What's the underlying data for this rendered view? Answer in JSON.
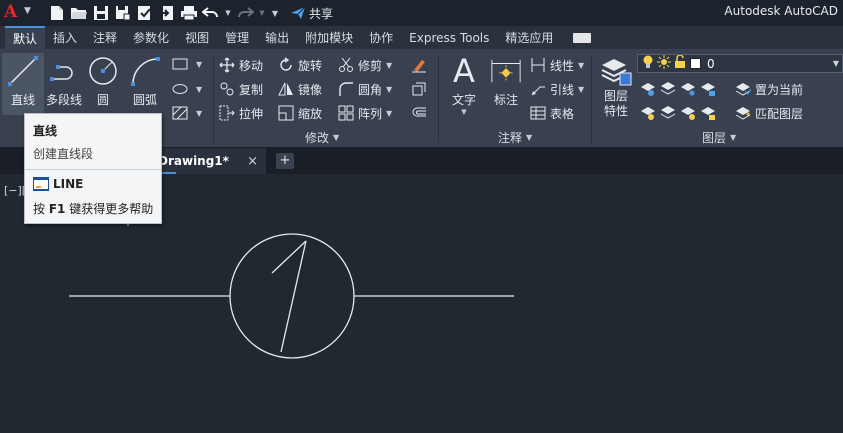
{
  "app": {
    "logo": "A",
    "title": "Autodesk AutoCAD",
    "share_label": "共享"
  },
  "ribbon_tabs": [
    "默认",
    "插入",
    "注释",
    "参数化",
    "视图",
    "管理",
    "输出",
    "附加模块",
    "协作",
    "Express Tools",
    "精选应用"
  ],
  "draw_panel": {
    "tools": [
      "直线",
      "多段线",
      "圆",
      "圆弧"
    ]
  },
  "modify_panel": {
    "label": "修改",
    "tools": [
      "移动",
      "旋转",
      "修剪",
      "复制",
      "镜像",
      "圆角",
      "拉伸",
      "缩放",
      "阵列"
    ]
  },
  "annotation_panel": {
    "label": "注释",
    "tools": [
      "文字",
      "标注",
      "线性",
      "引线",
      "表格"
    ]
  },
  "layers_panel": {
    "label": "图层",
    "properties_line1": "图层",
    "properties_line2": "特性",
    "current_layer": "0",
    "tools": [
      "置为当前",
      "匹配图层"
    ]
  },
  "document": {
    "tab_name": "Drawing1*",
    "close_glyph": "×",
    "add_glyph": "+"
  },
  "viewport": {
    "label": "[−]["
  },
  "tooltip": {
    "title": "直线",
    "description": "创建直线段",
    "command": "LINE",
    "help_prefix": "按 ",
    "help_key": "F1",
    "help_suffix": " 键获得更多帮助"
  },
  "colors": {
    "accent": "#4a90d9",
    "logo": "#e0282c",
    "background": "#212830",
    "ribbon": "#394150"
  }
}
